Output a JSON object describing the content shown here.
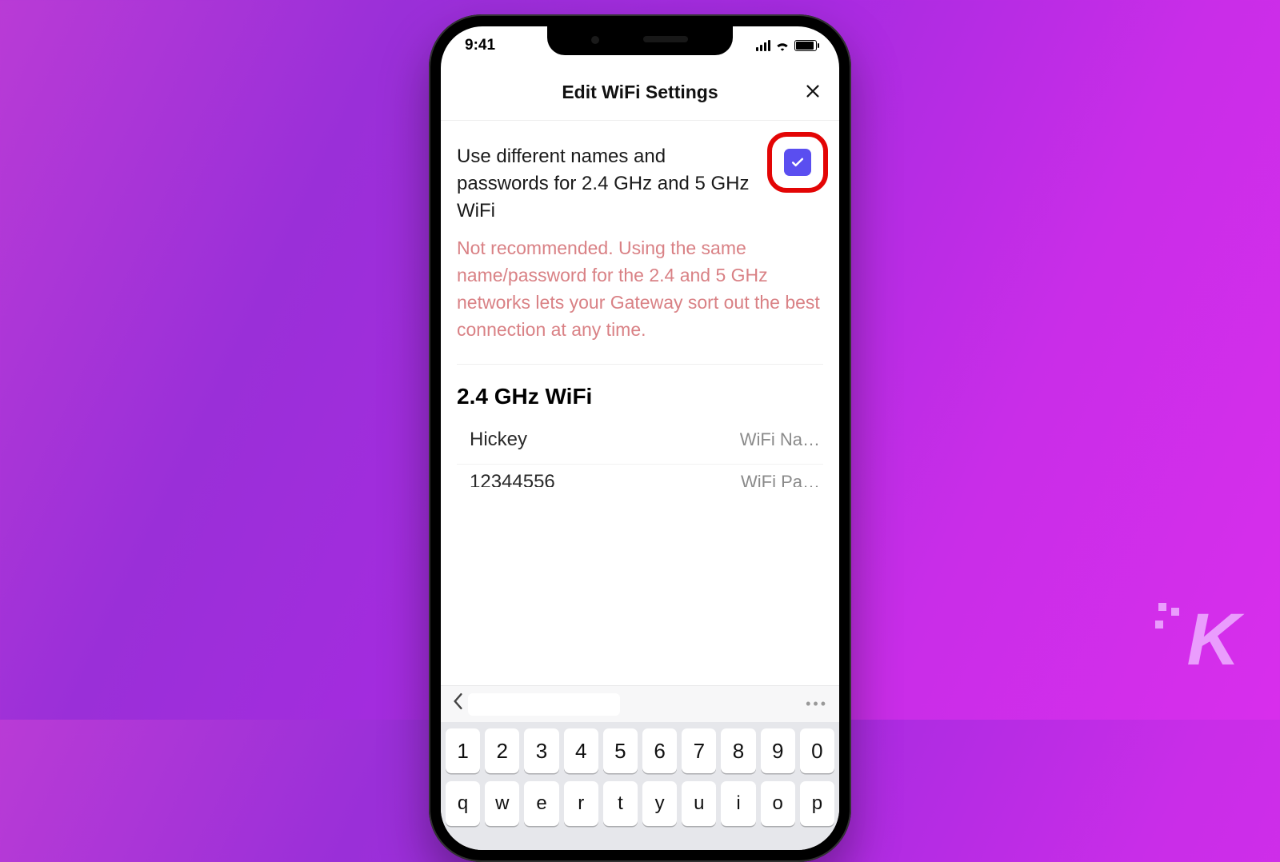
{
  "status": {
    "time": "9:41"
  },
  "header": {
    "title": "Edit WiFi Settings"
  },
  "toggle": {
    "label": "Use different names and passwords for 2.4 GHz and 5 GHz WiFi",
    "checked": true
  },
  "warning": "Not recommended. Using the same name/password for the 2.4 and 5 GHz networks lets your Gateway sort out the best connection at any time.",
  "section": {
    "title": "2.4 GHz WiFi",
    "fields": [
      {
        "value": "Hickey",
        "label": "WiFi Na…"
      },
      {
        "value": "12344556",
        "label": "WiFi Pa…"
      }
    ]
  },
  "keyboard": {
    "row_numbers": [
      "1",
      "2",
      "3",
      "4",
      "5",
      "6",
      "7",
      "8",
      "9",
      "0"
    ],
    "row_letters": [
      "q",
      "w",
      "e",
      "r",
      "t",
      "y",
      "u",
      "i",
      "o",
      "p"
    ]
  },
  "watermark": "K"
}
